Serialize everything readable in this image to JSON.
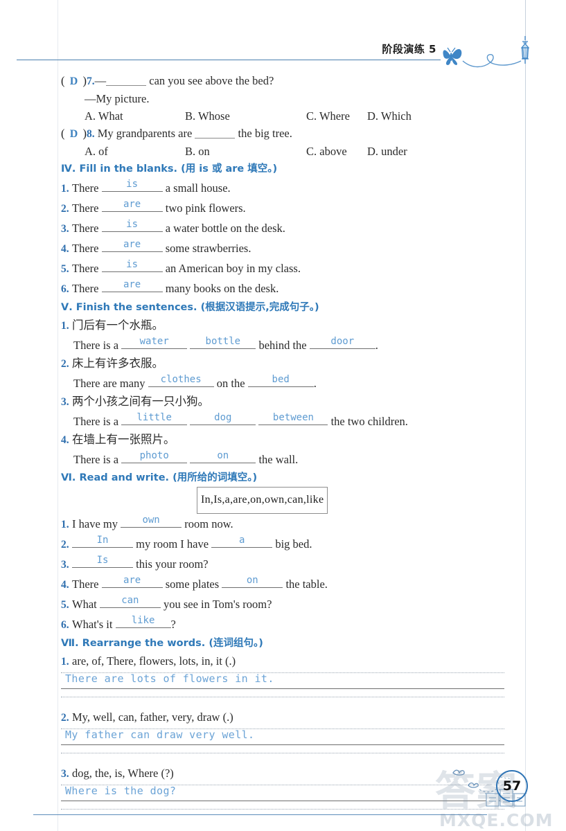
{
  "header": {
    "title": "阶段演练 5",
    "deco": [
      "butterfly-icon",
      "swirl-line",
      "street-lamp-icon"
    ]
  },
  "colors": {
    "heading_blue": "#2f79b8",
    "answer_blue": "#5e9bd1",
    "rule_blue": "#4a7fae",
    "page_circle_blue": "#2f74b5"
  },
  "multiple_choice": [
    {
      "mark_open": "(",
      "answer": "D",
      "mark_close": ")",
      "number": "7.",
      "stem_before": "—",
      "stem_after": "can you see above the bed?",
      "second_line": "—My picture.",
      "options": [
        "A. What",
        "B. Whose",
        "C. Where",
        "D. Which"
      ]
    },
    {
      "mark_open": "(",
      "answer": "D",
      "mark_close": ")",
      "number": "8.",
      "stem_before": "My grandparents are",
      "stem_after": "the big tree.",
      "second_line": "",
      "options": [
        "A. of",
        "B. on",
        "C. above",
        "D. under"
      ]
    }
  ],
  "section_4": {
    "heading": "Ⅳ. Fill in the blanks. (用 is 或 are 填空。)",
    "items": [
      {
        "number": "1.",
        "before": "There",
        "answer": "is",
        "after": "a small house."
      },
      {
        "number": "2.",
        "before": "There",
        "answer": "are",
        "after": "two pink flowers."
      },
      {
        "number": "3.",
        "before": "There",
        "answer": "is",
        "after": "a water bottle on the desk."
      },
      {
        "number": "4.",
        "before": "There",
        "answer": "are",
        "after": "some strawberries."
      },
      {
        "number": "5.",
        "before": "There",
        "answer": "is",
        "after": "an American boy in my class."
      },
      {
        "number": "6.",
        "before": "There",
        "answer": "are",
        "after": "many books on the desk."
      }
    ]
  },
  "section_5": {
    "heading": "Ⅴ. Finish the sentences. (根据汉语提示,完成句子。)",
    "items": [
      {
        "number": "1.",
        "chinese": "门后有一个水瓶。",
        "p1": "There is a",
        "a1": "water",
        "p2": "",
        "a2": "bottle",
        "p3": "behind the",
        "a3": "door",
        "p4": "."
      },
      {
        "number": "2.",
        "chinese": "床上有许多衣服。",
        "p1": "There are many",
        "a1": "clothes",
        "p2": "on the",
        "a2": "bed",
        "p3": "",
        "a3": "",
        "p4": "."
      },
      {
        "number": "3.",
        "chinese": "两个小孩之间有一只小狗。",
        "p1": "There is a",
        "a1": "little",
        "p2": "",
        "a2": "dog",
        "p3": "",
        "a3": "between",
        "p4": "the two children."
      },
      {
        "number": "4.",
        "chinese": "在墙上有一张照片。",
        "p1": "There is a",
        "a1": "photo",
        "p2": "",
        "a2": "on",
        "p3": "",
        "a3": "",
        "p4": "the wall."
      }
    ]
  },
  "section_6": {
    "heading": "Ⅵ. Read and write. (用所给的词填空。)",
    "word_bank": "In,Is,a,are,on,own,can,like",
    "items": [
      {
        "number": "1.",
        "p1": "I have my",
        "a1": "own",
        "p2": "room now.",
        "a2": "",
        "p3": ""
      },
      {
        "number": "2.",
        "p1": "",
        "a1": "In",
        "p2": "my room I have",
        "a2": "a",
        "p3": "big bed."
      },
      {
        "number": "3.",
        "p1": "",
        "a1": "Is",
        "p2": "this your room?",
        "a2": "",
        "p3": ""
      },
      {
        "number": "4.",
        "p1": "There",
        "a1": "are",
        "p2": "some plates",
        "a2": "on",
        "p3": "the table."
      },
      {
        "number": "5.",
        "p1": "What",
        "a1": "can",
        "p2": "you see in Tom's room?",
        "a2": "",
        "p3": ""
      },
      {
        "number": "6.",
        "p1": "What's it",
        "a1": "like",
        "p2": "?",
        "a2": "",
        "p3": ""
      }
    ]
  },
  "section_7": {
    "heading": "Ⅶ. Rearrange the words. (连词组句。)",
    "items": [
      {
        "number": "1.",
        "prompt": "are, of, There, flowers, lots, in, it (.)",
        "answer": "There are lots of flowers in it."
      },
      {
        "number": "2.",
        "prompt": "My, well, can, father, very, draw (.)",
        "answer": "My father can draw very well."
      },
      {
        "number": "3.",
        "prompt": "dog, the, is, Where (?)",
        "answer": "Where is the dog?"
      }
    ]
  },
  "footer": {
    "page_number": "57",
    "watermark_chars": "答案",
    "watermark_url": "MXQE.COM",
    "deco": [
      "birds-icon",
      "building-icon"
    ]
  }
}
